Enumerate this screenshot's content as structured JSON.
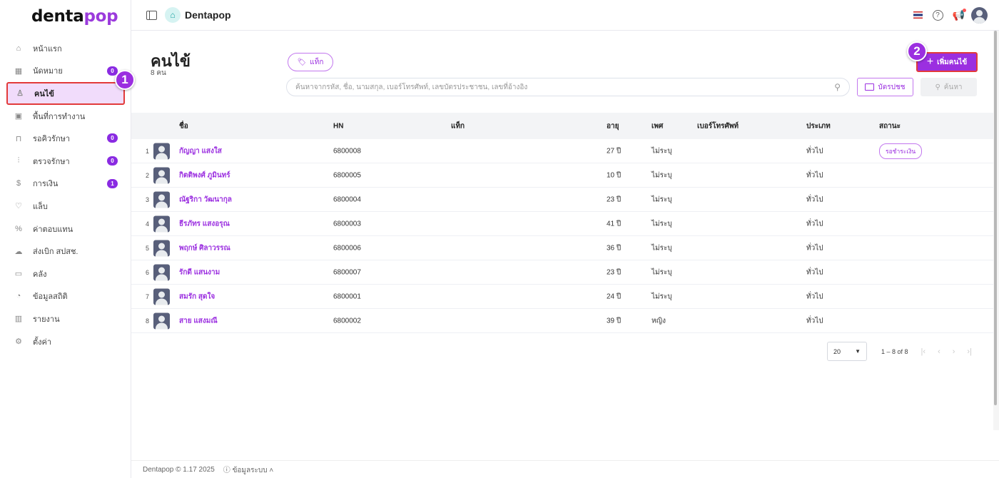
{
  "app": {
    "logo_text": "dentapop",
    "logo_main": "denta",
    "logo_accent": "pop",
    "title": "Dentapop"
  },
  "colors": {
    "accent": "#9b2fe0",
    "highlight": "#e23a3a",
    "active_bg": "#f1dcfb"
  },
  "sidebar": {
    "items": [
      {
        "label": "หน้าแรก",
        "icon": "home-icon"
      },
      {
        "label": "นัดหมาย",
        "icon": "calendar-icon",
        "badge": "0"
      },
      {
        "label": "คนไข้",
        "icon": "user-icon",
        "active": true
      },
      {
        "label": "พื้นที่การทำงาน",
        "icon": "workspace-icon"
      },
      {
        "label": "รอคิวรักษา",
        "icon": "chair-icon",
        "badge": "0"
      },
      {
        "label": "ตรวจรักษา",
        "icon": "tools-icon",
        "badge": "0"
      },
      {
        "label": "การเงิน",
        "icon": "money-hand-icon",
        "badge": "1"
      },
      {
        "label": "แล็บ",
        "icon": "tooth-icon"
      },
      {
        "label": "ค่าตอบแทน",
        "icon": "percent-icon"
      },
      {
        "label": "ส่งเบิก สปสช.",
        "icon": "cloud-check-icon"
      },
      {
        "label": "คลัง",
        "icon": "box-icon"
      },
      {
        "label": "ข้อมูลสถิติ",
        "icon": "stats-icon"
      },
      {
        "label": "รายงาน",
        "icon": "report-icon"
      },
      {
        "label": "ตั้งค่า",
        "icon": "settings-icon"
      }
    ]
  },
  "steps": {
    "one": "1",
    "two": "2"
  },
  "page": {
    "title": "คนไข้",
    "count": "8 คน",
    "tag_button": "แท็ก",
    "search_placeholder": "ค้นหาจากรหัส, ชื่อ, นามสกุล, เบอร์โทรศัพท์, เลขบัตรประชาชน, เลขที่อ้างอิง",
    "idcard_button": "บัตรปชช",
    "search_button": "ค้นหา",
    "add_button": "เพิ่มคนไข้"
  },
  "table": {
    "headers": {
      "name": "ชื่อ",
      "hn": "HN",
      "tag": "แท็ก",
      "age": "อายุ",
      "sex": "เพศ",
      "phone": "เบอร์โทรศัพท์",
      "type": "ประเภท",
      "status": "สถานะ"
    },
    "rows": [
      {
        "idx": "1",
        "name": "กัญญา แสงใส",
        "hn": "6800008",
        "age": "27 ปี",
        "sex": "ไม่ระบุ",
        "type": "ทั่วไป",
        "status": "รอชำระเงิน"
      },
      {
        "idx": "2",
        "name": "กิตติพงศ์ ภูมินทร์",
        "hn": "6800005",
        "age": "10 ปี",
        "sex": "ไม่ระบุ",
        "type": "ทั่วไป"
      },
      {
        "idx": "3",
        "name": "ณัฐริกา วัฒนากุล",
        "hn": "6800004",
        "age": "23 ปี",
        "sex": "ไม่ระบุ",
        "type": "ทั่วไป"
      },
      {
        "idx": "4",
        "name": "ธีรภัทร แสงอรุณ",
        "hn": "6800003",
        "age": "41 ปี",
        "sex": "ไม่ระบุ",
        "type": "ทั่วไป"
      },
      {
        "idx": "5",
        "name": "พฤกษ์ ศิลาวรรณ",
        "hn": "6800006",
        "age": "36 ปี",
        "sex": "ไม่ระบุ",
        "type": "ทั่วไป"
      },
      {
        "idx": "6",
        "name": "รักดี แสนงาม",
        "hn": "6800007",
        "age": "23 ปี",
        "sex": "ไม่ระบุ",
        "type": "ทั่วไป"
      },
      {
        "idx": "7",
        "name": "สมรัก สุดใจ",
        "hn": "6800001",
        "age": "24 ปี",
        "sex": "ไม่ระบุ",
        "type": "ทั่วไป"
      },
      {
        "idx": "8",
        "name": "สาย แสงมณี",
        "hn": "6800002",
        "age": "39 ปี",
        "sex": "หญิง",
        "type": "ทั่วไป"
      }
    ]
  },
  "pagination": {
    "page_size": "20",
    "range": "1 – 8 of 8"
  },
  "footer": {
    "copyright": "Dentapop © 1.17 2025",
    "system_info": "ข้อมูลระบบ"
  }
}
